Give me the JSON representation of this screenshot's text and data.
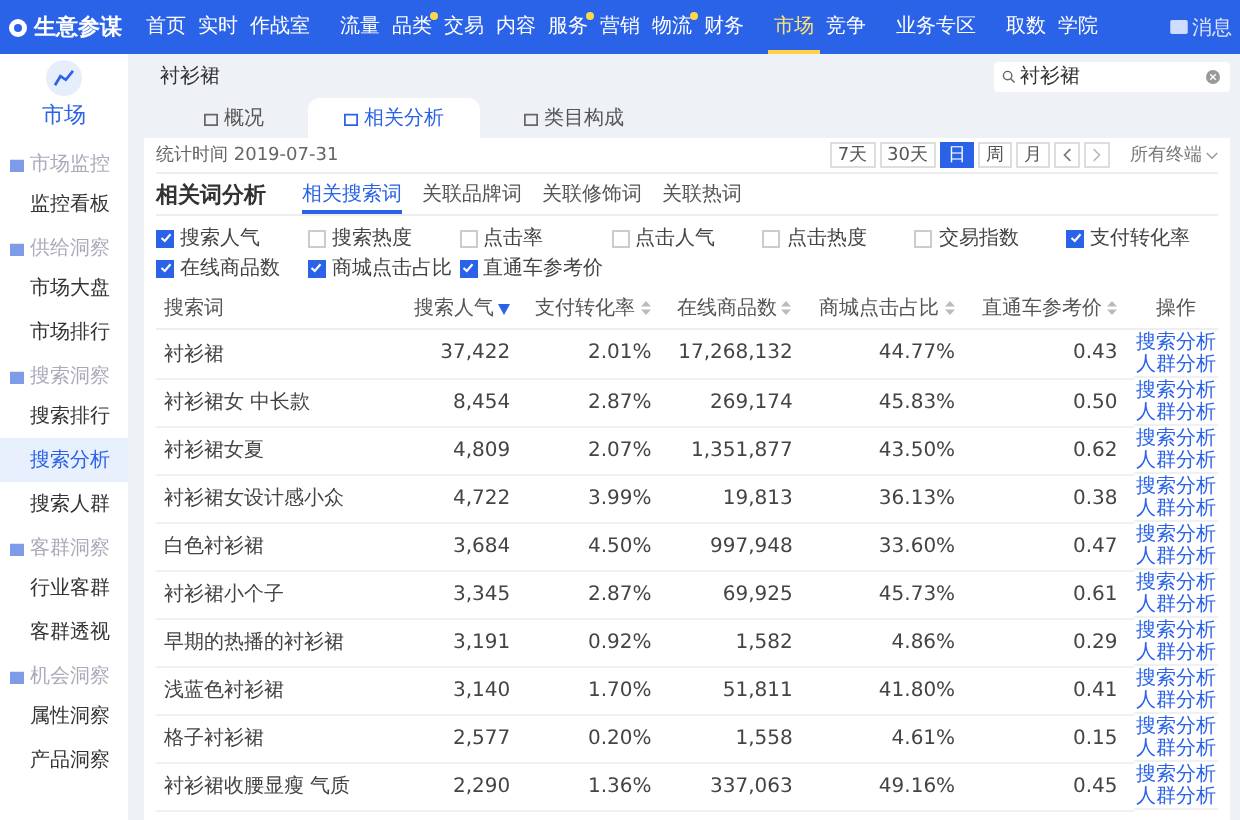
{
  "top_nav": {
    "logo": "生意参谋",
    "groups": [
      [
        {
          "label": "首页",
          "dot": false,
          "selected": false
        },
        {
          "label": "实时",
          "dot": false,
          "selected": false
        },
        {
          "label": "作战室",
          "dot": false,
          "selected": false
        }
      ],
      [
        {
          "label": "流量",
          "dot": false,
          "selected": false
        },
        {
          "label": "品类",
          "dot": true,
          "selected": false
        },
        {
          "label": "交易",
          "dot": false,
          "selected": false
        },
        {
          "label": "内容",
          "dot": false,
          "selected": false
        },
        {
          "label": "服务",
          "dot": true,
          "selected": false
        },
        {
          "label": "营销",
          "dot": false,
          "selected": false
        },
        {
          "label": "物流",
          "dot": true,
          "selected": false
        },
        {
          "label": "财务",
          "dot": false,
          "selected": false
        }
      ],
      [
        {
          "label": "市场",
          "dot": false,
          "selected": true
        },
        {
          "label": "竞争",
          "dot": false,
          "selected": false
        }
      ],
      [
        {
          "label": "业务专区",
          "dot": false,
          "selected": false
        }
      ],
      [
        {
          "label": "取数",
          "dot": false,
          "selected": false
        },
        {
          "label": "学院",
          "dot": false,
          "selected": false
        }
      ]
    ],
    "messages": "消息"
  },
  "sidebar": {
    "title": "市场",
    "groups": [
      {
        "title": "市场监控",
        "items": [
          {
            "label": "监控看板",
            "selected": false
          }
        ]
      },
      {
        "title": "供给洞察",
        "items": [
          {
            "label": "市场大盘",
            "selected": false
          },
          {
            "label": "市场排行",
            "selected": false
          }
        ]
      },
      {
        "title": "搜索洞察",
        "items": [
          {
            "label": "搜索排行",
            "selected": false
          },
          {
            "label": "搜索分析",
            "selected": true
          },
          {
            "label": "搜索人群",
            "selected": false
          }
        ]
      },
      {
        "title": "客群洞察",
        "items": [
          {
            "label": "行业客群",
            "selected": false
          },
          {
            "label": "客群透视",
            "selected": false
          }
        ]
      },
      {
        "title": "机会洞察",
        "items": [
          {
            "label": "属性洞察",
            "selected": false
          },
          {
            "label": "产品洞察",
            "selected": false
          }
        ]
      }
    ]
  },
  "header": {
    "title": "衬衫裙",
    "search": {
      "value": "衬衫裙"
    },
    "tabs": [
      {
        "label": "概况",
        "selected": false
      },
      {
        "label": "相关分析",
        "selected": true
      },
      {
        "label": "类目构成",
        "selected": false
      }
    ]
  },
  "stats_time": "统计时间 2019-07-31",
  "period_buttons": [
    {
      "label": "7天",
      "selected": false
    },
    {
      "label": "30天",
      "selected": false
    },
    {
      "label": "日",
      "selected": true
    },
    {
      "label": "周",
      "selected": false
    },
    {
      "label": "月",
      "selected": false
    }
  ],
  "device_select": "所有终端",
  "section": {
    "title": "相关词分析",
    "tabs": [
      {
        "label": "相关搜索词",
        "selected": true
      },
      {
        "label": "关联品牌词",
        "selected": false
      },
      {
        "label": "关联修饰词",
        "selected": false
      },
      {
        "label": "关联热词",
        "selected": false
      }
    ]
  },
  "metrics": [
    {
      "label": "搜索人气",
      "checked": true
    },
    {
      "label": "搜索热度",
      "checked": false
    },
    {
      "label": "点击率",
      "checked": false
    },
    {
      "label": "点击人气",
      "checked": false
    },
    {
      "label": "点击热度",
      "checked": false
    },
    {
      "label": "交易指数",
      "checked": false
    },
    {
      "label": "支付转化率",
      "checked": true
    },
    {
      "label": "在线商品数",
      "checked": true
    },
    {
      "label": "商城点击占比",
      "checked": true
    },
    {
      "label": "直通车参考价",
      "checked": true
    }
  ],
  "table": {
    "columns": [
      {
        "label": "搜索词",
        "sortable": false
      },
      {
        "label": "搜索人气",
        "sortable": true,
        "sorted": true
      },
      {
        "label": "支付转化率",
        "sortable": true,
        "sorted": false
      },
      {
        "label": "在线商品数",
        "sortable": true,
        "sorted": false
      },
      {
        "label": "商城点击占比",
        "sortable": true,
        "sorted": false
      },
      {
        "label": "直通车参考价",
        "sortable": true,
        "sorted": false
      },
      {
        "label": "操作",
        "sortable": false
      }
    ],
    "rows": [
      {
        "cells": [
          "衬衫裙",
          "37,422",
          "2.01%",
          "17,268,132",
          "44.77%",
          "0.43"
        ],
        "actions": [
          "搜索分析",
          "人群分析"
        ]
      },
      {
        "cells": [
          "衬衫裙女 中长款",
          "8,454",
          "2.87%",
          "269,174",
          "45.83%",
          "0.50"
        ],
        "actions": [
          "搜索分析",
          "人群分析"
        ]
      },
      {
        "cells": [
          "衬衫裙女夏",
          "4,809",
          "2.07%",
          "1,351,877",
          "43.50%",
          "0.62"
        ],
        "actions": [
          "搜索分析",
          "人群分析"
        ]
      },
      {
        "cells": [
          "衬衫裙女设计感小众",
          "4,722",
          "3.99%",
          "19,813",
          "36.13%",
          "0.38"
        ],
        "actions": [
          "搜索分析",
          "人群分析"
        ]
      },
      {
        "cells": [
          "白色衬衫裙",
          "3,684",
          "4.50%",
          "997,948",
          "33.60%",
          "0.47"
        ],
        "actions": [
          "搜索分析",
          "人群分析"
        ]
      },
      {
        "cells": [
          "衬衫裙小个子",
          "3,345",
          "2.87%",
          "69,925",
          "45.73%",
          "0.61"
        ],
        "actions": [
          "搜索分析",
          "人群分析"
        ]
      },
      {
        "cells": [
          "早期的热播的衬衫裙",
          "3,191",
          "0.92%",
          "1,582",
          "4.86%",
          "0.29"
        ],
        "actions": [
          "搜索分析",
          "人群分析"
        ]
      },
      {
        "cells": [
          "浅蓝色衬衫裙",
          "3,140",
          "1.70%",
          "51,811",
          "41.80%",
          "0.41"
        ],
        "actions": [
          "搜索分析",
          "人群分析"
        ]
      },
      {
        "cells": [
          "格子衬衫裙",
          "2,577",
          "0.20%",
          "1,558",
          "4.61%",
          "0.15"
        ],
        "actions": [
          "搜索分析",
          "人群分析"
        ]
      },
      {
        "cells": [
          "衬衫裙收腰显瘦 气质",
          "2,290",
          "1.36%",
          "337,063",
          "49.16%",
          "0.45"
        ],
        "actions": [
          "搜索分析",
          "人群分析"
        ]
      }
    ]
  }
}
